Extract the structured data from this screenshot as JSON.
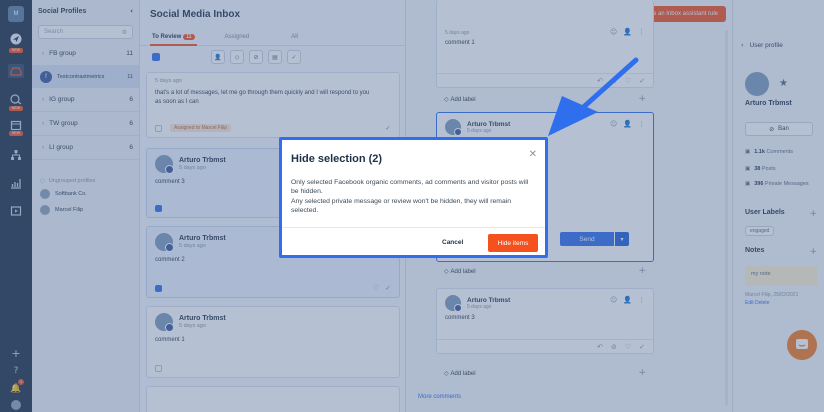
{
  "rail": {
    "avatar_initials": "M",
    "new_badge": "NEW"
  },
  "profiles": {
    "title": "Social Profiles",
    "search_placeholder": "Search",
    "groups": [
      {
        "name": "FB group",
        "count": "11"
      },
      {
        "name": "IG group",
        "count": "6"
      },
      {
        "name": "TW group",
        "count": "6"
      },
      {
        "name": "LI group",
        "count": "6"
      }
    ],
    "selected_profile": "Testcontrastmetrics",
    "selected_count": "11",
    "unprofiled_label": "Ungrouped profiles",
    "unprofiled": [
      {
        "name": "Softbank Co.",
        "count": ""
      },
      {
        "name": "Marcel Filip",
        "count": ""
      }
    ]
  },
  "inbox": {
    "title": "Social Media Inbox",
    "tabs": [
      {
        "label": "To Review",
        "count": "11"
      },
      {
        "label": "Assigned"
      },
      {
        "label": "All"
      }
    ],
    "cards": [
      {
        "name": "",
        "ago": "5 days ago",
        "text": "that's a lot of messages, let me go through them quickly and I will respond to you as soon as I can",
        "assigned": "Assigned to Marcel Filip"
      },
      {
        "name": "Arturo Trbmst",
        "ago": "5 days ago",
        "text": "comment 3"
      },
      {
        "name": "Arturo Trbmst",
        "ago": "5 days ago",
        "text": "comment 2"
      },
      {
        "name": "Arturo Trbmst",
        "ago": "5 days ago",
        "text": "comment 1"
      }
    ]
  },
  "conv": {
    "create_button": "Create an Inbox assistant rule",
    "comments": [
      {
        "name": "",
        "ago": "5 days ago",
        "text": "comment 1"
      },
      {
        "name": "Arturo Trbmst",
        "ago": "5 days ago",
        "text": ""
      },
      {
        "name": "Arturo Trbmst",
        "ago": "5 days ago",
        "text": "comment 3"
      }
    ],
    "add_label": "Add label",
    "send": "Send",
    "more_comments": "More comments"
  },
  "right": {
    "title": "User profile",
    "user_name": "Arturo Trbmst",
    "ban": "Ban",
    "stats": [
      {
        "value": "1.1k",
        "label": "Comments"
      },
      {
        "value": "38",
        "label": "Posts"
      },
      {
        "value": "396",
        "label": "Private Messages"
      }
    ],
    "user_labels_title": "User Labels",
    "label_tag": "engaged",
    "notes_title": "Notes",
    "note_text": "my note",
    "note_author": "Marcel Filip, 25/02/2021",
    "note_edit": "Edit",
    "note_delete": "Delete"
  },
  "modal": {
    "title": "Hide selection (2)",
    "body_line1": "Only selected Facebook organic comments, ad comments and visitor posts will be hidden.",
    "body_line2": "Any selected private message or review won't be hidden, they will remain selected.",
    "cancel": "Cancel",
    "confirm": "Hide items"
  },
  "colors": {
    "accent": "#f4511e",
    "primary": "#2f6fed",
    "sidebar": "#1f3145"
  }
}
